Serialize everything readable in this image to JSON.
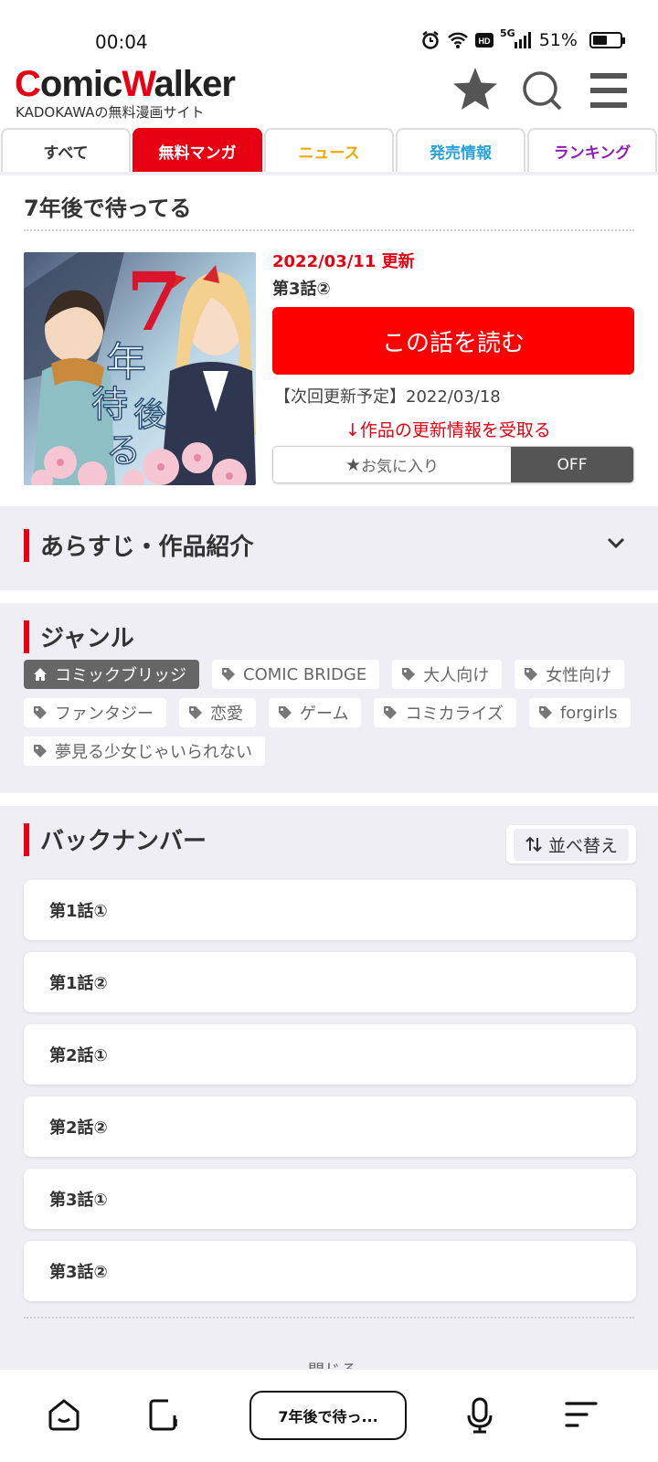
{
  "status": {
    "time": "00:04",
    "network": "5G",
    "battery": "51%"
  },
  "header": {
    "logo_part1": "C",
    "logo_part2": "omic",
    "logo_part3": "W",
    "logo_part4": "alker",
    "tagline": "KADOKAWAの無料漫画サイト"
  },
  "tabs": [
    {
      "label": "すべて",
      "color": "#333333"
    },
    {
      "label": "無料マンガ",
      "color": "#ffffff"
    },
    {
      "label": "ニュース",
      "color": "#f2a900"
    },
    {
      "label": "発売情報",
      "color": "#2aa1d8"
    },
    {
      "label": "ランキング",
      "color": "#8e1fb3"
    }
  ],
  "work": {
    "title": "7年後で待ってる",
    "update_date": "2022/03/11 更新",
    "latest_episode": "第3話②",
    "read_button": "この話を読む",
    "next_update": "【次回更新予定】2022/03/18",
    "notify_link": "↓作品の更新情報を受取る",
    "favorite_label": "お気に入り",
    "favorite_state": "OFF"
  },
  "synopsis": {
    "heading": "あらすじ・作品紹介"
  },
  "genre": {
    "heading": "ジャンル",
    "tags": [
      "コミックブリッジ",
      "COMIC BRIDGE",
      "大人向け",
      "女性向け",
      "ファンタジー",
      "恋愛",
      "ゲーム",
      "コミカライズ",
      "forgirls",
      "夢見る少女じゃいられない"
    ]
  },
  "backnumber": {
    "heading": "バックナンバー",
    "sort_label": "並べ替え",
    "episodes": [
      "第1話①",
      "第1話②",
      "第2話①",
      "第2話②",
      "第3話①",
      "第3話②"
    ],
    "close_label": "閉じる"
  },
  "browser": {
    "url_title": "7年後で待っ..."
  },
  "colors": {
    "accent": "#e60012",
    "section_bg": "#eeeef4"
  }
}
